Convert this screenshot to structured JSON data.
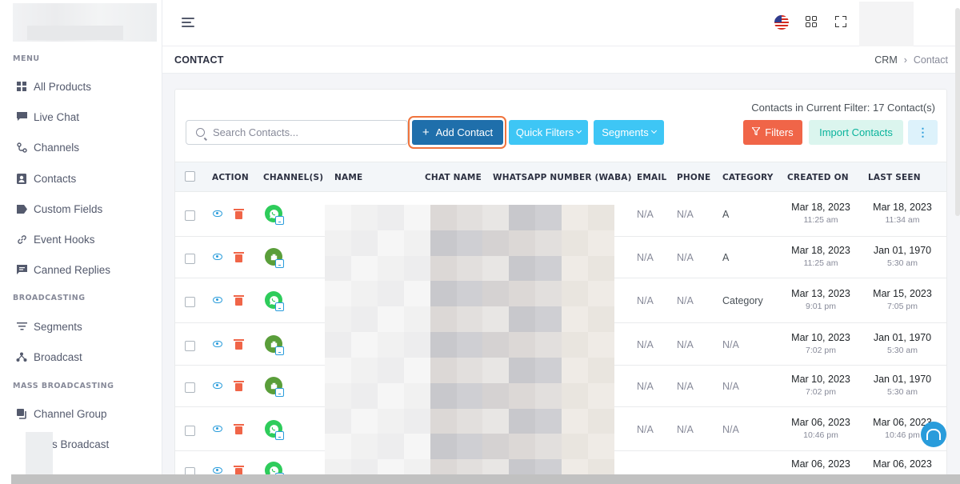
{
  "sidebar": {
    "sections": {
      "menu": "MENU",
      "broadcasting": "BROADCASTING",
      "mass_broadcasting": "MASS BROADCASTING"
    },
    "items": [
      {
        "label": "All Products",
        "icon": "grid-icon"
      },
      {
        "label": "Live Chat",
        "icon": "chat-icon"
      },
      {
        "label": "Channels",
        "icon": "channels-icon"
      },
      {
        "label": "Contacts",
        "icon": "contact-card-icon"
      },
      {
        "label": "Custom Fields",
        "icon": "tag-icon"
      },
      {
        "label": "Event Hooks",
        "icon": "link-icon"
      },
      {
        "label": "Canned Replies",
        "icon": "message-icon"
      },
      {
        "label": "Segments",
        "icon": "filter-lines-icon"
      },
      {
        "label": "Broadcast",
        "icon": "broadcast-icon"
      },
      {
        "label": "Channel Group",
        "icon": "copy-icon"
      },
      {
        "label": "s Broadcast",
        "icon": ""
      }
    ]
  },
  "header": {
    "page_title": "CONTACT",
    "breadcrumb": [
      "CRM",
      "Contact"
    ]
  },
  "toolbar": {
    "filter_info": "Contacts in Current Filter: 17 Contact(s)",
    "search_placeholder": "Search Contacts...",
    "add_contact": "Add Contact",
    "quick_filters": "Quick Filters",
    "segments": "Segments",
    "filters": "Filters",
    "import_contacts": "Import Contacts",
    "more": "⋮"
  },
  "table": {
    "columns": [
      "ACTION",
      "CHANNEL(S)",
      "NAME",
      "CHAT NAME",
      "WHATSAPP NUMBER (WABA)",
      "EMAIL",
      "PHONE",
      "CATEGORY",
      "CREATED ON",
      "LAST SEEN"
    ],
    "rows": [
      {
        "email": "N/A",
        "phone": "N/A",
        "category": "A",
        "created_date": "Mar 18, 2023",
        "created_time": "11:25 am",
        "seen_date": "Mar 18, 2023",
        "seen_time": "11:34 am",
        "channel": "whatsapp"
      },
      {
        "email": "N/A",
        "phone": "N/A",
        "category": "A",
        "created_date": "Mar 18, 2023",
        "created_time": "11:25 am",
        "seen_date": "Jan 01, 1970",
        "seen_time": "5:30 am",
        "channel": "business"
      },
      {
        "email": "N/A",
        "phone": "N/A",
        "category": "Category",
        "created_date": "Mar 13, 2023",
        "created_time": "9:01 pm",
        "seen_date": "Mar 15, 2023",
        "seen_time": "7:05 pm",
        "channel": "whatsapp"
      },
      {
        "email": "N/A",
        "phone": "N/A",
        "category": "N/A",
        "created_date": "Mar 10, 2023",
        "created_time": "7:02 pm",
        "seen_date": "Jan 01, 1970",
        "seen_time": "5:30 am",
        "channel": "business"
      },
      {
        "email": "N/A",
        "phone": "N/A",
        "category": "N/A",
        "created_date": "Mar 10, 2023",
        "created_time": "7:02 pm",
        "seen_date": "Jan 01, 1970",
        "seen_time": "5:30 am",
        "channel": "business"
      },
      {
        "email": "N/A",
        "phone": "N/A",
        "category": "N/A",
        "created_date": "Mar 06, 2023",
        "created_time": "10:46 pm",
        "seen_date": "Mar 06, 2023",
        "seen_time": "10:46 pm",
        "channel": "whatsapp"
      },
      {
        "email": "",
        "phone": "",
        "category": "",
        "created_date": "Mar 06, 2023",
        "created_time": "",
        "seen_date": "Mar 06, 2023",
        "seen_time": "",
        "channel": "whatsapp"
      }
    ]
  },
  "colors": {
    "primary": "#1f6fab",
    "info": "#3ec6f5",
    "danger": "#f06548",
    "success": "#0ab39c",
    "highlight_ring": "#f0743d"
  }
}
